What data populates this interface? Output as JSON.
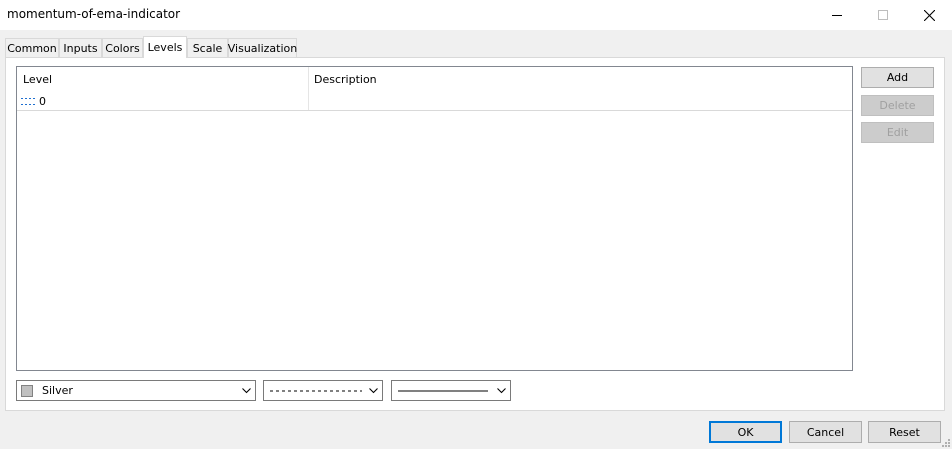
{
  "window": {
    "title": "momentum-of-ema-indicator",
    "icons": [
      "minimize-icon",
      "maximize-icon",
      "close-icon"
    ]
  },
  "tabs": [
    {
      "label": "Common",
      "active": false
    },
    {
      "label": "Inputs",
      "active": false
    },
    {
      "label": "Colors",
      "active": false
    },
    {
      "label": "Levels",
      "active": true
    },
    {
      "label": "Scale",
      "active": false
    },
    {
      "label": "Visualization",
      "active": false
    }
  ],
  "levels": {
    "columns": {
      "level": "Level",
      "description": "Description"
    },
    "rows": [
      {
        "level": "0",
        "description": "",
        "icon": "dotted-line-icon"
      }
    ]
  },
  "side_buttons": {
    "add": "Add",
    "delete": "Delete",
    "edit": "Edit"
  },
  "style": {
    "color_label": "Silver",
    "color_value": "#c0c0c0"
  },
  "footer": {
    "ok": "OK",
    "cancel": "Cancel",
    "reset": "Reset"
  },
  "colors": {
    "accent": "#0078d7"
  }
}
